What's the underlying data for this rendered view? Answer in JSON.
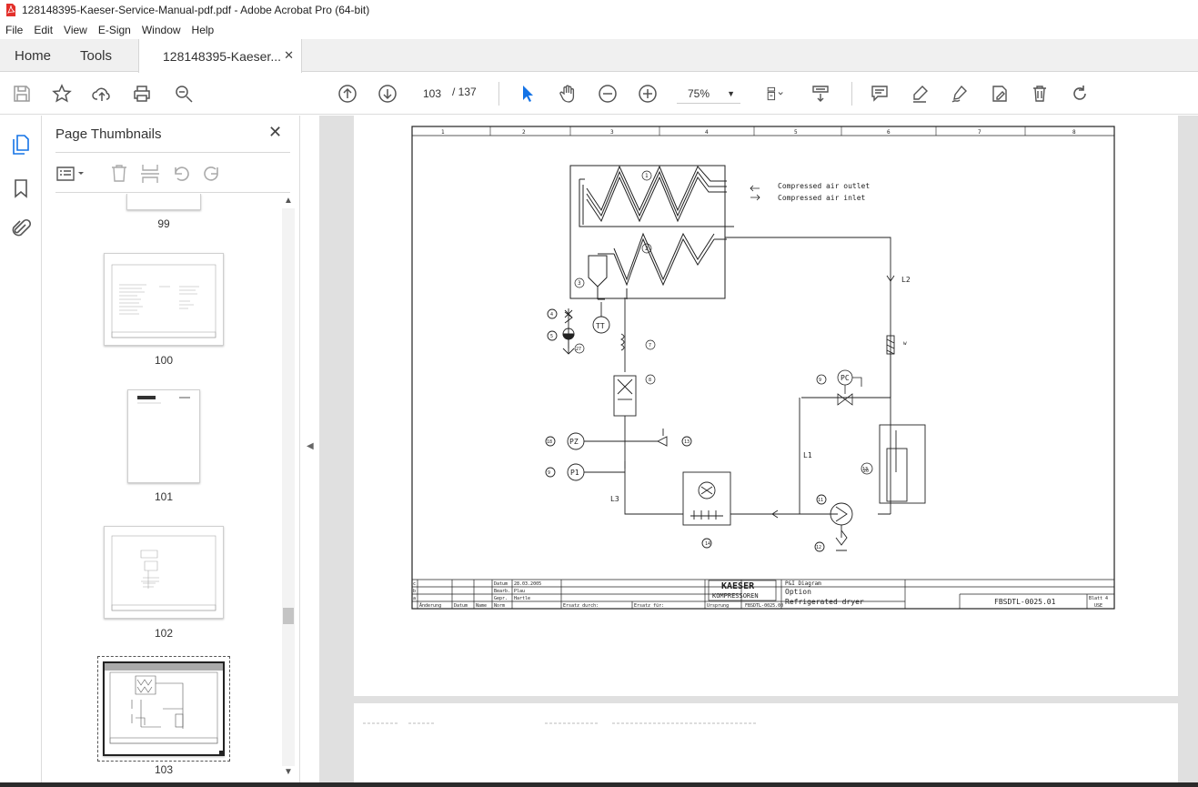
{
  "window": {
    "title": "128148395-Kaeser-Service-Manual-pdf.pdf - Adobe Acrobat Pro (64-bit)"
  },
  "menu": [
    "File",
    "Edit",
    "View",
    "E-Sign",
    "Window",
    "Help"
  ],
  "tabs": {
    "home": "Home",
    "tools": "Tools",
    "document": "128148395-Kaeser..."
  },
  "toolbar": {
    "current_page": "103",
    "page_total": "/  137",
    "zoom": "75%"
  },
  "sidebar": {
    "title": "Page Thumbnails",
    "thumbnails": [
      {
        "label": "99"
      },
      {
        "label": "100"
      },
      {
        "label": "101"
      },
      {
        "label": "102"
      },
      {
        "label": "103",
        "selected": true
      }
    ]
  },
  "drawing": {
    "column_numbers": [
      "1",
      "2",
      "3",
      "4",
      "5",
      "6",
      "7",
      "8"
    ],
    "outlet_label": "Compressed air outlet",
    "inlet_label": "Compressed air inlet",
    "line_labels": {
      "l1": "L1",
      "l2": "L2",
      "l3": "L3"
    },
    "instruments": {
      "tt": "TT",
      "pz": "PZ",
      "p1": "P1",
      "pc": "PC"
    },
    "callouts": [
      "1",
      "2",
      "3",
      "4",
      "5",
      "27",
      "7",
      "8",
      "18",
      "9",
      "13",
      "19",
      "20",
      "11",
      "12",
      "10",
      "14"
    ],
    "title_block": {
      "date_label": "Datum",
      "date_value": "28.03.2005",
      "drawn_label": "Bearb.",
      "drawn_value": "Plau",
      "checked_label": "Gepr.",
      "checked_value": "Hartle",
      "norm_label": "Norm",
      "revision_cols": [
        "Änderung",
        "Datum",
        "Name"
      ],
      "replaced_by": "Ersatz durch:",
      "replaces": "Ersatz für:",
      "origin": "Ursprung",
      "origin_value": "FBSDTL-0025.00",
      "brand_line1": "KAESER",
      "brand_line2": "KOMPRESSOREN",
      "diagram_line1": "P&I Diagram",
      "diagram_line2": "Option",
      "diagram_line3": "Refrigerated dryer",
      "drawing_number": "FBSDTL-0025.01",
      "sheet": "Blatt 4",
      "sheet_of": "USE",
      "row_marks": [
        "c",
        "b",
        "a"
      ]
    }
  }
}
